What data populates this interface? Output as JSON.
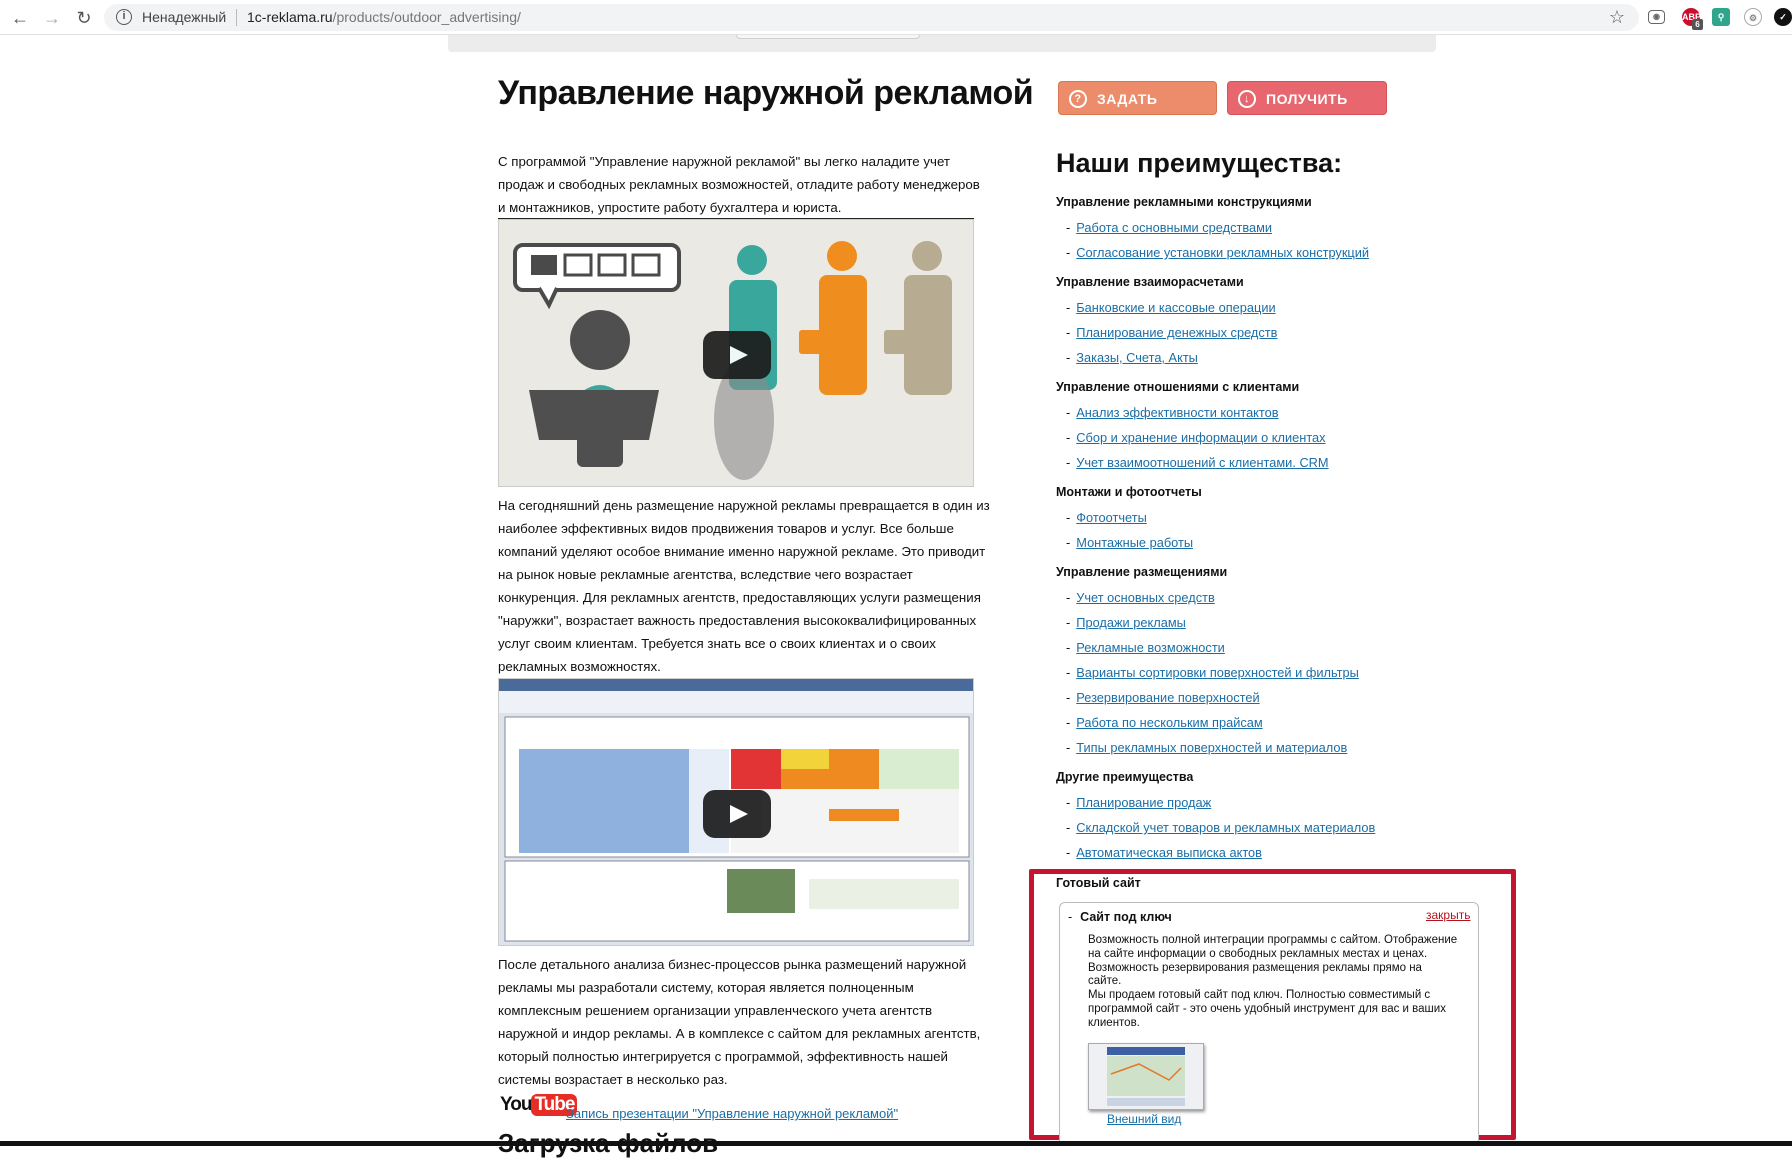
{
  "browser": {
    "security_label": "Ненадежный",
    "url_host": "1c-reklama.ru",
    "url_path": "/products/outdoor_advertising/",
    "ext_badge": "6"
  },
  "page": {
    "title": "Управление наружной рекламой",
    "buttons": {
      "ask": "Задать вопрос",
      "demo": "Получить демо"
    },
    "intro": "С программой \"Управление наружной рекламой\" вы легко наладите учет продаж и свободных рекламных возможностей, отладите работу менеджеров и монтажников, упростите работу бухгалтера и юриста.",
    "para2": "На сегодняшний день размещение наружной рекламы превращается в один из наиболее эффективных видов продвижения товаров и услуг. Все больше компаний уделяют особое внимание именно наружной рекламе. Это приводит на рынок новые рекламные агентства, вследствие чего возрастает конкуренция. Для рекламных агентств, предоставляющих услуги размещения \"наружки\", возрастает важность предоставления высококвалифицированных услуг своим клиентам. Требуется знать все о своих клиентах и о своих рекламных возможностях.",
    "para3": "После детального анализа бизнес-процессов рынка размещений наружной рекламы мы разработали систему, которая является полноценным комплексным решением организации управленческого учета агентств наружной и индор рекламы. А в комплексе с сайтом для рекламных агентств, который полностью интегрируется с программой, эффективность нашей системы возрастает в несколько раз.",
    "yt_you": "You",
    "yt_tube": "Tube",
    "yt_link": "Запись презентации \"Управление наружной рекламой\"",
    "next_heading": "Загрузка файлов"
  },
  "advantages": {
    "title": "Наши преимущества:",
    "sections": [
      {
        "heading": "Управление рекламными конструкциями",
        "items": [
          "Работа с основными средствами",
          "Согласование установки рекламных конструкций"
        ]
      },
      {
        "heading": "Управление взаиморасчетами",
        "items": [
          "Банковские и кассовые операции",
          "Планирование денежных средств",
          "Заказы, Счета, Акты"
        ]
      },
      {
        "heading": "Управление отношениями с клиентами",
        "items": [
          "Анализ эффективности контактов",
          "Сбор и хранение информации о клиентах",
          "Учет взаимоотношений с клиентами. CRM"
        ]
      },
      {
        "heading": "Монтажи и фотоотчеты",
        "items": [
          "Фотоотчеты",
          "Монтажные работы"
        ]
      },
      {
        "heading": "Управление размещениями",
        "items": [
          "Учет основных средств",
          "Продажи рекламы",
          "Рекламные возможности",
          "Варианты сортировки поверхностей и фильтры",
          "Резервирование поверхностей",
          "Работа по нескольким прайсам",
          "Типы рекламных поверхностей и материалов"
        ]
      },
      {
        "heading": "Другие преимущества",
        "items": [
          "Планирование продаж",
          "Складской учет товаров и рекламных материалов",
          "Автоматическая выписка актов"
        ]
      }
    ],
    "ready_site": {
      "heading": "Готовый сайт",
      "item_title": "Сайт под ключ",
      "close": "закрыть",
      "text1": "Возможность полной интеграции программы с сайтом. Отображение на сайте информации о свободных рекламных местах и ценах. Возможность резервирования размещения рекламы прямо на сайте.",
      "text2": "Мы продаем готовый сайт под ключ. Полностью совместимый с программой сайт - это очень удобный инструмент для вас и ваших клиентов.",
      "thumb_link": "Внешний вид"
    }
  }
}
